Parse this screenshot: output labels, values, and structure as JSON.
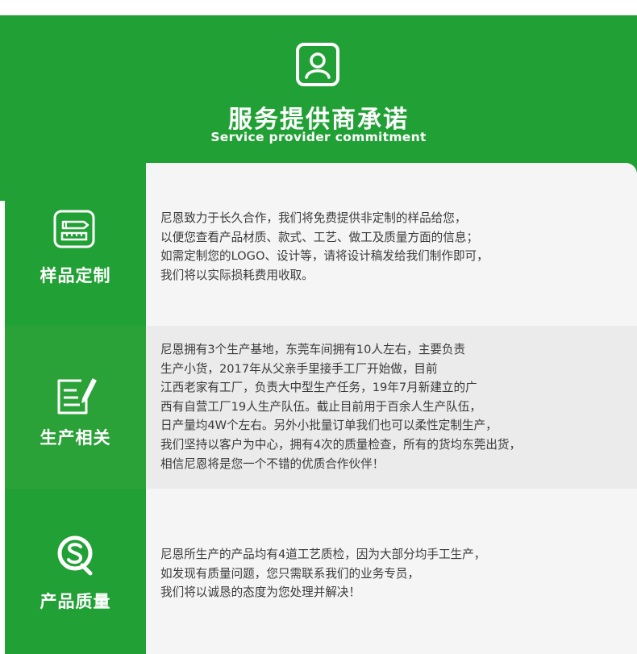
{
  "header": {
    "title": "服务提供商承诺",
    "subtitle": "Service provider commitment",
    "icon": "person-icon"
  },
  "colors": {
    "brand_green": "#21a135",
    "text": "#3a3a3a",
    "panel_light": "#f5f5f5",
    "panel_gray": "#ebebeb"
  },
  "sections": [
    {
      "title": "样品定制",
      "icon": "ruler-pencil-icon",
      "lines": [
        "尼恩致力于长久合作，我们将免费提供非定制的样品给您，",
        "以便您查看产品材质、款式、工艺、做工及质量方面的信息；",
        "如需定制您的LOGO、设计等，请将设计稿发给我们制作即可，",
        "我们将以实际损耗费用收取。"
      ]
    },
    {
      "title": "生产相关",
      "icon": "document-pen-icon",
      "lines": [
        "尼恩拥有3个生产基地，东莞车间拥有10人左右，主要负责",
        "生产小货，2017年从父亲手里接手工厂开始做，目前",
        "江西老家有工厂，负责大中型生产任务，19年7月新建立的广",
        "西有自营工厂19人生产队伍。截止目前用于百余人生产队伍，",
        "日产量均4W个左右。另外小批量订单我们也可以柔性定制生产，",
        "我们坚持以客户为中心，拥有4次的质量检查，所有的货均东莞出货，",
        "相信尼恩将是您一个不错的优质合作伙伴！"
      ]
    },
    {
      "title": "产品质量",
      "icon": "quality-seal-icon",
      "lines": [
        "尼恩所生产的产品均有4道工艺质检，因为大部分均手工生产，",
        "如发现有质量问题，您只需联系我们的业务专员，",
        "我们将以诚恳的态度为您处理并解决！"
      ]
    }
  ]
}
